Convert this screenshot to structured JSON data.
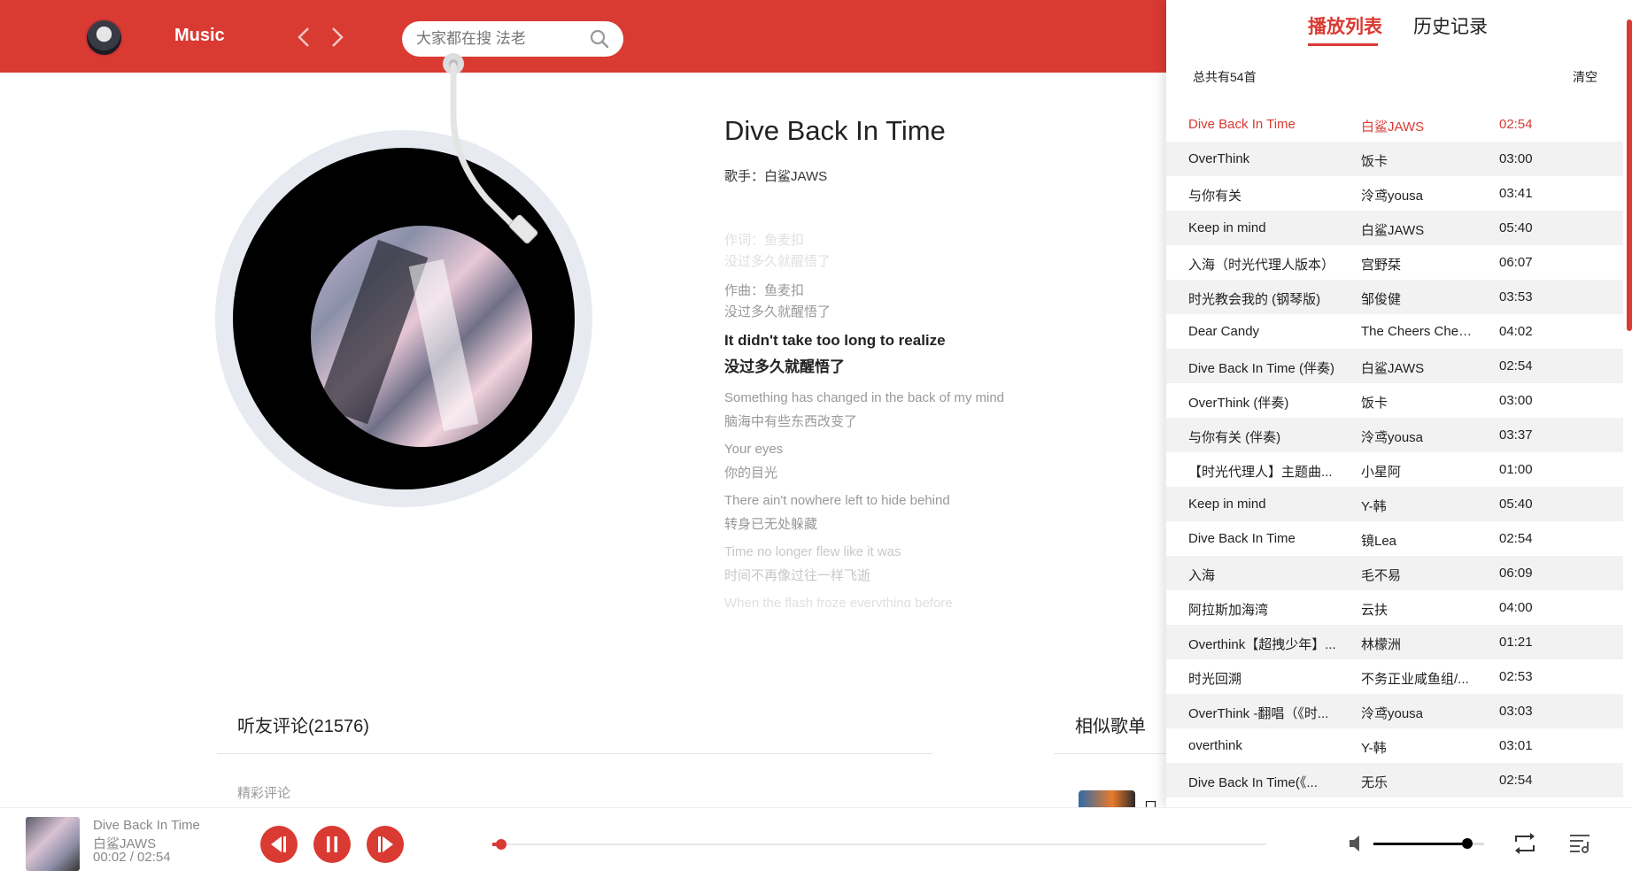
{
  "header": {
    "brand": "Music",
    "search_placeholder": "大家都在搜 法老"
  },
  "song": {
    "title": "Dive Back In Time",
    "singer": "歌手：白鲨JAWS"
  },
  "lyrics": [
    {
      "text": "作词：鱼麦扣",
      "tone": "faint"
    },
    {
      "text": "没过多久就醒悟了",
      "tone": "faint"
    },
    {
      "text": "作曲：鱼麦扣",
      "tone": "normal"
    },
    {
      "text": "没过多久就醒悟了",
      "tone": "normal"
    },
    {
      "text": "It didn't take too long to realize",
      "tone": "active"
    },
    {
      "text": "没过多久就醒悟了",
      "tone": "active"
    },
    {
      "text": "Something has changed in the back of my mind",
      "tone": "normal"
    },
    {
      "text": "脑海中有些东西改变了",
      "tone": "normal"
    },
    {
      "text": "Your eyes",
      "tone": "normal"
    },
    {
      "text": "你的目光",
      "tone": "normal"
    },
    {
      "text": "There ain't nowhere left to hide behind",
      "tone": "normal"
    },
    {
      "text": "转身已无处躲藏",
      "tone": "normal"
    },
    {
      "text": "Time no longer flew like it was",
      "tone": "light"
    },
    {
      "text": "时间不再像过往一样飞逝",
      "tone": "light"
    },
    {
      "text": "When the flash froze everything before",
      "tone": "faint"
    }
  ],
  "comments": {
    "title": "听友评论(21576)",
    "hot_label": "精彩评论"
  },
  "similar": {
    "title": "相似歌单",
    "first_item_text": "口昆"
  },
  "panel": {
    "tabs": [
      "播放列表",
      "历史记录"
    ],
    "active_tab": 0,
    "total": "总共有54首",
    "clear": "清空",
    "current_index": 0,
    "rows": [
      {
        "name": "Dive Back In Time",
        "artist": "白鲨JAWS",
        "time": "02:54"
      },
      {
        "name": "OverThink",
        "artist": "饭卡",
        "time": "03:00"
      },
      {
        "name": "与你有关",
        "artist": "泠鸢yousa",
        "time": "03:41"
      },
      {
        "name": "Keep in mind",
        "artist": "白鲨JAWS",
        "time": "05:40"
      },
      {
        "name": "入海（时光代理人版本）",
        "artist": "宫野栞",
        "time": "06:07"
      },
      {
        "name": "时光教会我的 (钢琴版)",
        "artist": "邹俊健",
        "time": "03:53"
      },
      {
        "name": "Dear Candy",
        "artist": "The Cheers Cheers",
        "time": "04:02"
      },
      {
        "name": "Dive Back In Time (伴奏)",
        "artist": "白鲨JAWS",
        "time": "02:54"
      },
      {
        "name": "OverThink (伴奏)",
        "artist": "饭卡",
        "time": "03:00"
      },
      {
        "name": "与你有关 (伴奏)",
        "artist": "泠鸢yousa",
        "time": "03:37"
      },
      {
        "name": "【时光代理人】主题曲...",
        "artist": "小星阿",
        "time": "01:00"
      },
      {
        "name": "Keep in mind",
        "artist": "Y-韩",
        "time": "05:40"
      },
      {
        "name": "Dive Back In Time",
        "artist": "镜Lea",
        "time": "02:54"
      },
      {
        "name": "入海",
        "artist": "毛不易",
        "time": "06:09"
      },
      {
        "name": "阿拉斯加海湾",
        "artist": "云扶",
        "time": "04:00"
      },
      {
        "name": "Overthink【超拽少年】...",
        "artist": "林檬洲",
        "time": "01:21"
      },
      {
        "name": "时光回溯",
        "artist": "不务正业咸鱼组/...",
        "time": "02:53"
      },
      {
        "name": "OverThink -翻唱（《时...",
        "artist": "泠鸢yousa",
        "time": "03:03"
      },
      {
        "name": "overthink",
        "artist": "Y-韩",
        "time": "03:01"
      },
      {
        "name": "Dive Back In Time(《...",
        "artist": "无乐",
        "time": "02:54"
      }
    ]
  },
  "player": {
    "title": "Dive Back In Time",
    "artist": "白鲨JAWS",
    "time": "00:02 / 02:54",
    "progress": 0.011,
    "volume": 0.85
  },
  "colors": {
    "accent": "#d93a32",
    "header_bg": "#d93a32"
  },
  "icons": [
    "avatar",
    "back-arrow-icon",
    "forward-arrow-icon",
    "search-icon",
    "prev-icon",
    "pause-icon",
    "next-icon",
    "volume-icon",
    "loop-icon",
    "playlist-icon"
  ]
}
